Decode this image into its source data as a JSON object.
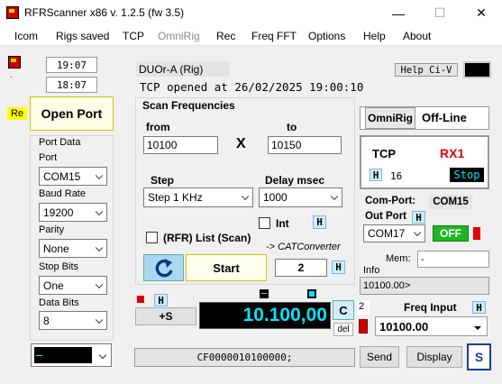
{
  "window": {
    "title": "RFRScanner  x86 v. 1.2.5  (fw 3.5)",
    "minimize": "—",
    "maximize": "☐",
    "close": "✕"
  },
  "menu": [
    "Icom",
    "Rigs saved",
    "TCP",
    "OmniRig",
    "Rec",
    "Freq FFT",
    "Options",
    "Help",
    "About"
  ],
  "left": {
    "time1": "19:07",
    "time2": "18:07",
    "re_label": "Re",
    "open_port": "Open Port",
    "port_data_title": "Port Data",
    "port_label": "Port",
    "port_value": "COM15",
    "baud_label": "Baud Rate",
    "baud_value": "19200",
    "parity_label": "Parity",
    "parity_value": "None",
    "stop_label": "Stop Bits",
    "stop_value": "One",
    "data_label": "Data Bits",
    "data_value": "8"
  },
  "status": {
    "rig_name": "DUOr-A (Rig)",
    "tcp_msg": "TCP opened at 26/02/2025 19:00:10",
    "help_civ": "Help Ci-V"
  },
  "scan": {
    "title": "Scan Frequencies",
    "from_label": "from",
    "from_value": "10100",
    "x_label": "X",
    "to_label": "to",
    "to_value": "10150",
    "step_label": "Step",
    "step_value": "Step 1 KHz",
    "delay_label": "Delay  msec",
    "delay_value": "1000",
    "int_label": "Int",
    "rfr_list_label": "(RFR) List (Scan)",
    "cat_converter": "-> CATConverter",
    "start": "Start",
    "count": "2",
    "h": "H"
  },
  "freq": {
    "plus_s": "+S",
    "display": "10.100,00",
    "c": "C",
    "del": "del",
    "cat_cmd": "CF0000010100000;"
  },
  "right": {
    "omnirig": "OmniRig",
    "offline": "Off-Line",
    "tcp": "TCP",
    "rx": "RX1",
    "h": "H",
    "num": "16",
    "stop": "Stop",
    "com_port_label": "Com-Port:",
    "com_port_value": "COM15",
    "out_port_label": "Out Port",
    "out_port_value": "COM17",
    "off": "OFF",
    "mem_label": "Mem:",
    "mem_value": "-",
    "info_label": "Info",
    "info_value": "10100.00>",
    "freq_input_num": "2",
    "freq_input_label": "Freq Input",
    "freq_input_value": "10100.00"
  },
  "bottom": {
    "send": "Send",
    "display": "Display",
    "s": "S"
  },
  "colors": {
    "accent_cyan": "#00e5ff",
    "freq_display_bg": "#000000",
    "ok_green": "#1fb51f",
    "rx_red": "#e00000"
  }
}
